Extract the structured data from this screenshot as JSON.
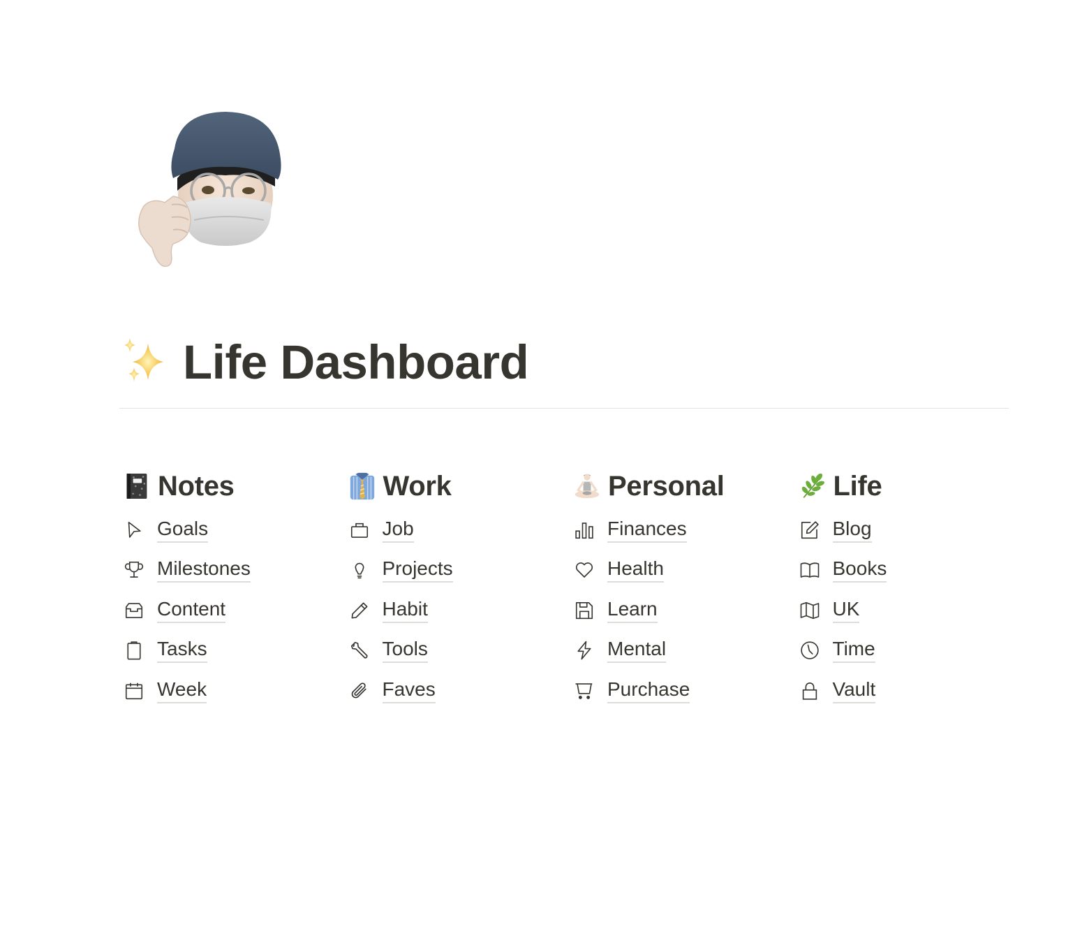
{
  "page": {
    "cover_icon": "memoji-thumbs-down-avatar",
    "title_emoji": "sparkles",
    "title": "Life Dashboard"
  },
  "columns": [
    {
      "title": "Notes",
      "emoji": "notebook",
      "items": [
        {
          "label": "Goals",
          "icon": "cursor-arrow-icon"
        },
        {
          "label": "Milestones",
          "icon": "trophy-icon"
        },
        {
          "label": "Content",
          "icon": "inbox-tray-icon"
        },
        {
          "label": "Tasks",
          "icon": "clipboard-icon"
        },
        {
          "label": "Week",
          "icon": "calendar-icon"
        }
      ]
    },
    {
      "title": "Work",
      "emoji": "shirt-and-tie",
      "items": [
        {
          "label": "Job",
          "icon": "briefcase-icon"
        },
        {
          "label": "Projects",
          "icon": "lightbulb-icon"
        },
        {
          "label": "Habit",
          "icon": "pencil-icon"
        },
        {
          "label": "Tools",
          "icon": "wrench-icon"
        },
        {
          "label": "Faves",
          "icon": "paperclip-icon"
        }
      ]
    },
    {
      "title": "Personal",
      "emoji": "person-meditating",
      "items": [
        {
          "label": "Finances",
          "icon": "bar-chart-icon"
        },
        {
          "label": "Health",
          "icon": "heart-icon"
        },
        {
          "label": "Learn",
          "icon": "floppy-disk-icon"
        },
        {
          "label": "Mental",
          "icon": "lightning-bolt-icon"
        },
        {
          "label": "Purchase",
          "icon": "shopping-cart-icon"
        }
      ]
    },
    {
      "title": "Life",
      "emoji": "herb",
      "items": [
        {
          "label": "Blog",
          "icon": "edit-note-icon"
        },
        {
          "label": "Books",
          "icon": "open-book-icon"
        },
        {
          "label": "UK",
          "icon": "map-icon"
        },
        {
          "label": "Time",
          "icon": "clock-icon"
        },
        {
          "label": "Vault",
          "icon": "lock-icon"
        }
      ]
    }
  ],
  "colors": {
    "text": "#37352f",
    "divider": "#e3e2e0",
    "underline": "#dddcd9"
  }
}
